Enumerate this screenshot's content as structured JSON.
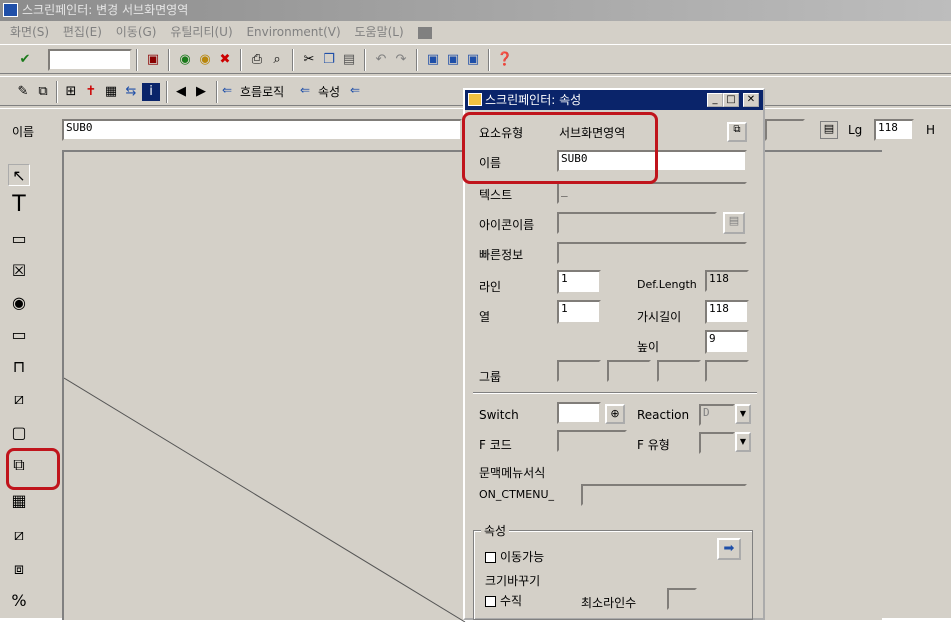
{
  "window": {
    "title": "스크린페인터: 변경 서브화면영역"
  },
  "menu": [
    "화면(S)",
    "편집(E)",
    "이동(G)",
    "유틸리티(U)",
    "Environment(V)",
    "도움말(L)"
  ],
  "toolbar2": {
    "flow_logic": "흐름로직",
    "attributes": "속성"
  },
  "name_bar": {
    "label": "이름",
    "value": "SUB0",
    "lg_label": "Lg",
    "lg_value": "118",
    "h_label": "H"
  },
  "dialog": {
    "title": "스크린페인터: 속성",
    "element_type_label": "요소유형",
    "element_type_value": "서브화면영역",
    "name_label": "이름",
    "name_value": "SUB0",
    "text_label": "텍스트",
    "text_value": "_",
    "icon_name_label": "아이콘이름",
    "quick_info_label": "빠른정보",
    "line_label": "라인",
    "line_value": "1",
    "def_length_label": "Def.Length",
    "def_length_value": "118",
    "column_label": "열",
    "column_value": "1",
    "visible_length_label": "가시길이",
    "visible_length_value": "118",
    "height_label": "높이",
    "height_value": "9",
    "group_label": "그룹",
    "switch_label": "Switch",
    "reaction_label": "Reaction",
    "reaction_value": "D",
    "fcode_label": "F 코드",
    "ftype_label": "F 유형",
    "context_menu_label": "문맥메뉴서식",
    "context_menu_prefix": "ON_CTMENU_",
    "attributes_group": "속성",
    "movable_label": "이동가능",
    "resize_label": "크기바꾸기",
    "vertical_label": "수직",
    "min_lines_label": "최소라인수"
  }
}
